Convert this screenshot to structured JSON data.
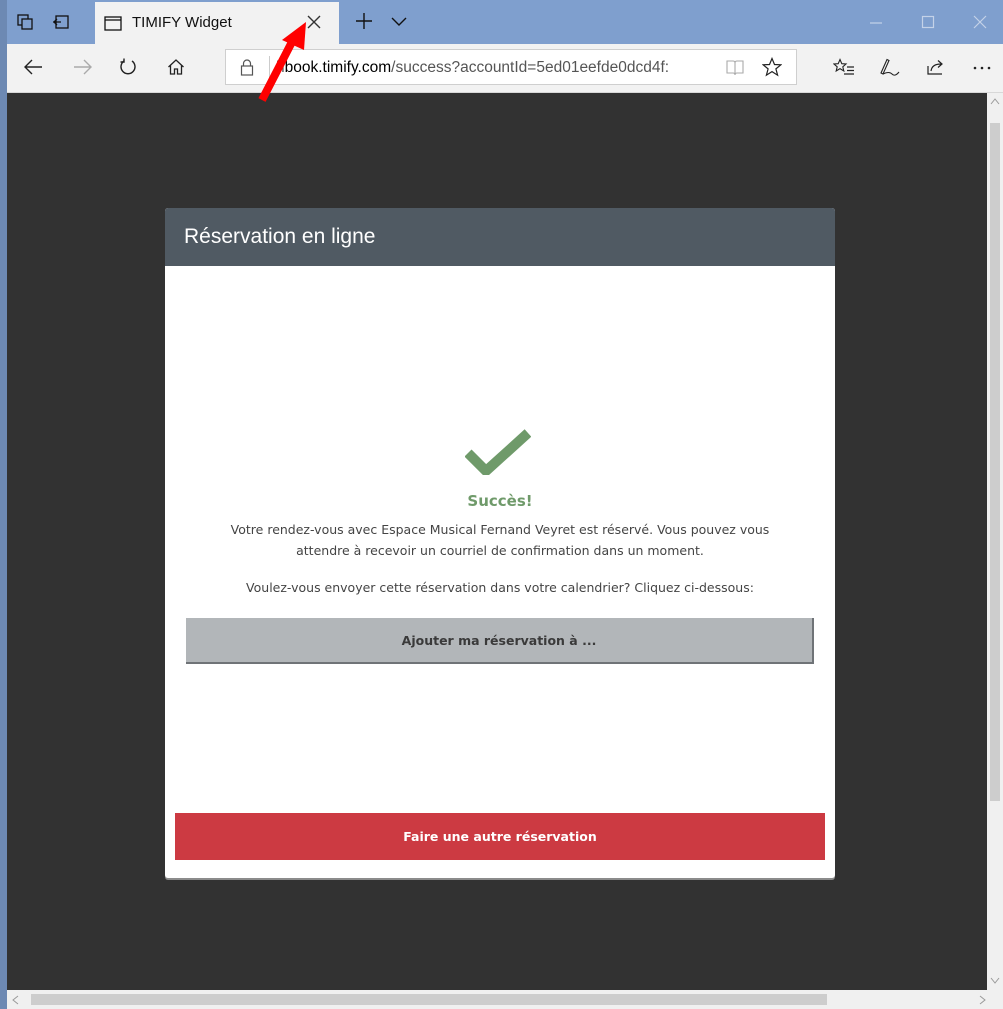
{
  "browser": {
    "tab_title": "TIMIFY Widget",
    "url_prefix": "h",
    "url_domain": "book.timify.com",
    "url_rest": "/success?accountId=5ed01eefde0dcd4f:",
    "accent_color": "#7f9fce"
  },
  "icons": {
    "tab_bar": [
      "tab-preview-icon",
      "set-aside-tabs-icon",
      "page-icon",
      "close-icon",
      "new-tab-plus-icon",
      "tab-list-chevron-icon",
      "minimize-icon",
      "maximize-icon",
      "window-close-icon"
    ],
    "nav": [
      "back-icon",
      "forward-icon",
      "refresh-icon",
      "home-icon",
      "lock-icon",
      "reading-view-icon",
      "favorite-star-icon",
      "favorites-list-icon",
      "pen-icon",
      "share-icon",
      "more-icon"
    ]
  },
  "widget": {
    "header": "Réservation en ligne",
    "success_title": "Succès!",
    "message_line1": "Votre rendez-vous avec Espace Musical Fernand Veyret est réservé. Vous pouvez vous",
    "message_line2": "attendre à recevoir un courriel de confirmation dans un moment.",
    "calendar_prompt": "Voulez-vous envoyer cette réservation dans votre calendrier? Cliquez ci-dessous:",
    "add_button": "Ajouter ma réservation à ...",
    "other_button": "Faire une autre réservation",
    "header_color": "#505a63",
    "success_color": "#6f9a6a",
    "primary_button_color": "#cc3a42"
  }
}
